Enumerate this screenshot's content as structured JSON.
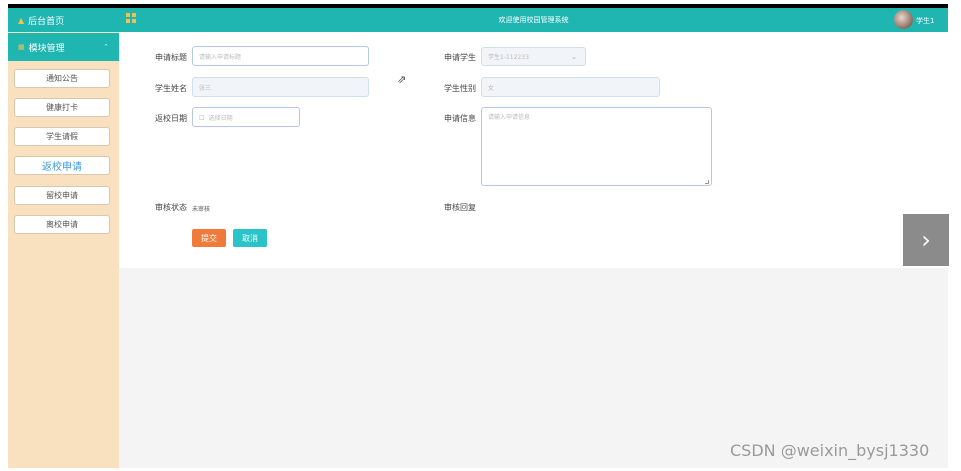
{
  "sidebar": {
    "home_label": "后台首页",
    "group_label": "模块管理",
    "items": [
      {
        "label": "通知公告"
      },
      {
        "label": "健康打卡"
      },
      {
        "label": "学生请假"
      },
      {
        "label": "返校申请"
      },
      {
        "label": "留校申请"
      },
      {
        "label": "离校申请"
      }
    ],
    "active_index": 3
  },
  "header": {
    "title": "欢迎使用校园管理系统",
    "username": "学生1"
  },
  "form": {
    "title_label": "申请标题",
    "title_placeholder": "请输入申请标题",
    "student_label": "申请学生",
    "student_value": "学生1-112233",
    "name_label": "学生姓名",
    "name_value": "张三",
    "gender_label": "学生性别",
    "gender_value": "女",
    "date_label": "返校日期",
    "date_placeholder": "选择日期",
    "info_label": "申请信息",
    "info_placeholder": "请输入申请信息",
    "status_label": "审核状态",
    "status_value": "未审核",
    "reply_label": "审核回复",
    "submit_label": "提交",
    "cancel_label": "取消"
  },
  "watermark": "CSDN @weixin_bysj1330",
  "colors": {
    "accent": "#1fb5b1",
    "sidebar_bg": "#f9e0bf",
    "submit": "#f07a3a",
    "cancel": "#29c3c8"
  }
}
